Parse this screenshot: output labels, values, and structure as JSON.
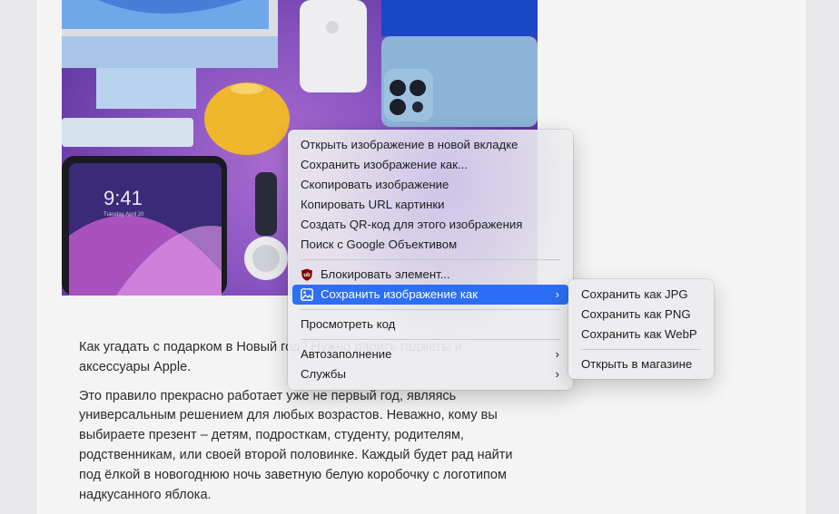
{
  "context_menu": {
    "items": [
      {
        "label": "Открыть изображение в новой вкладке"
      },
      {
        "label": "Сохранить изображение как..."
      },
      {
        "label": "Скопировать изображение"
      },
      {
        "label": "Копировать URL картинки"
      },
      {
        "label": "Создать QR-код для этого изображения"
      },
      {
        "label": "Поиск с Google Объективом"
      },
      {
        "label": "Блокировать элемент...",
        "icon": "ublock-shield-icon"
      },
      {
        "label": "Сохранить изображение как",
        "icon": "image-icon",
        "submenu": true,
        "highlighted": true
      },
      {
        "label": "Просмотреть код"
      },
      {
        "label": "Автозаполнение",
        "submenu": true
      },
      {
        "label": "Службы",
        "submenu": true
      }
    ]
  },
  "submenu": {
    "items": [
      {
        "label": "Сохранить как JPG"
      },
      {
        "label": "Сохранить как PNG"
      },
      {
        "label": "Сохранить как WebP"
      },
      {
        "label": "Открыть в магазине"
      }
    ]
  },
  "hero_image": {
    "clock_time": "9:41",
    "clock_date": "Tuesday April 20"
  },
  "article": {
    "paragraph1": "Как угадать с подарком в Новый год? Нужно дарить гаджеты и аксессуары Apple.",
    "paragraph2": "Это правило прекрасно работает уже не первый год, являясь универсальным решением для любых возрастов. Неважно, кому вы выбираете презент – детям, подросткам, студенту, родителям, родственникам, или своей второй половинке. Каждый будет рад найти под ёлкой в новогоднюю ночь заветную белую коробочку с логотипом надкусанного яблока."
  },
  "colors": {
    "highlight": "#2c6ff4",
    "ublock": "#800000"
  }
}
